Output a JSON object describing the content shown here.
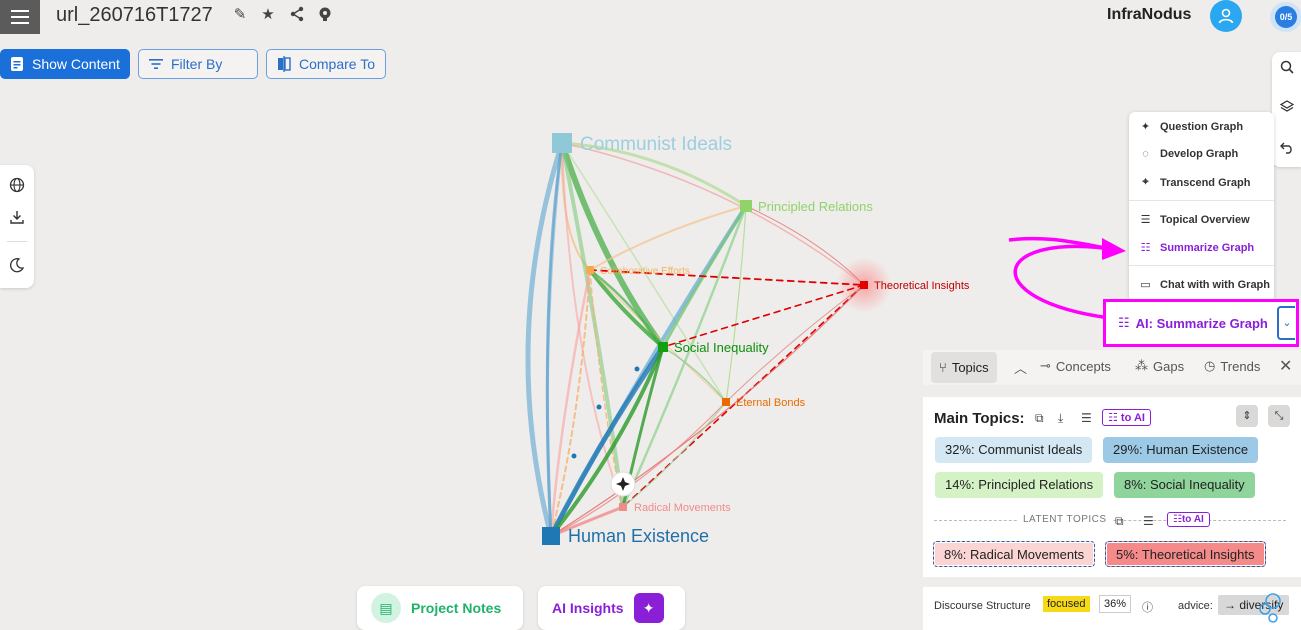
{
  "header": {
    "title": "url_260716T1727",
    "brand": "InfraNodus",
    "counter": "0/5"
  },
  "toolbar": {
    "show_content": "Show Content",
    "filter_by": "Filter By",
    "compare_to": "Compare To"
  },
  "graph": {
    "nodes": [
      {
        "label": "Communist Ideals",
        "color": "#8fc8d6"
      },
      {
        "label": "Principled Relations",
        "color": "#8fd36a"
      },
      {
        "label": "Collaborative Efforts",
        "color": "#f5a94a"
      },
      {
        "label": "Theoretical Insights",
        "color": "#e00000"
      },
      {
        "label": "Social Inequality",
        "color": "#12a012"
      },
      {
        "label": "Eternal Bonds",
        "color": "#e86a00"
      },
      {
        "label": "Radical Movements",
        "color": "#f08b8b"
      },
      {
        "label": "Human Existence",
        "color": "#1f78b4"
      }
    ]
  },
  "ai_menu": {
    "items": [
      {
        "label": "Question Graph",
        "icon": "sparkle-icon"
      },
      {
        "label": "Develop Graph",
        "icon": "lightbulb-icon"
      },
      {
        "label": "Transcend Graph",
        "icon": "telescope-icon"
      },
      {
        "label": "Topical Overview",
        "icon": "list-icon"
      },
      {
        "label": "Summarize Graph",
        "icon": "summary-list-icon"
      },
      {
        "label": "Chat with with Graph",
        "icon": "chat-icon"
      }
    ],
    "main_button": "AI: Summarize Graph"
  },
  "panel": {
    "tabs": [
      "Topics",
      "Concepts",
      "Gaps",
      "Trends"
    ],
    "main_topics_title": "Main Topics:",
    "to_ai": "to AI",
    "latent_label": "LATENT TOPICS",
    "main_topics": [
      {
        "label": "32%: Communist Ideals",
        "color": "#d3e8f2"
      },
      {
        "label": "29%: Human Existence",
        "color": "#9ccae6"
      },
      {
        "label": "14%: Principled Relations",
        "color": "#d5f2c6"
      },
      {
        "label": "8%: Social Inequality",
        "color": "#8fd49a"
      }
    ],
    "latent_topics": [
      {
        "label": "8%: Radical Movements",
        "color": "#fbd4d4"
      },
      {
        "label": "5%: Theoretical Insights",
        "color": "#f48a8a"
      }
    ]
  },
  "discourse": {
    "label": "Discourse Structure",
    "state": "focused",
    "percent": "36%",
    "advice_label": "advice:",
    "advice": "→ diversify"
  },
  "bottom": {
    "project_notes": "Project Notes",
    "ai_insights": "AI Insights"
  }
}
